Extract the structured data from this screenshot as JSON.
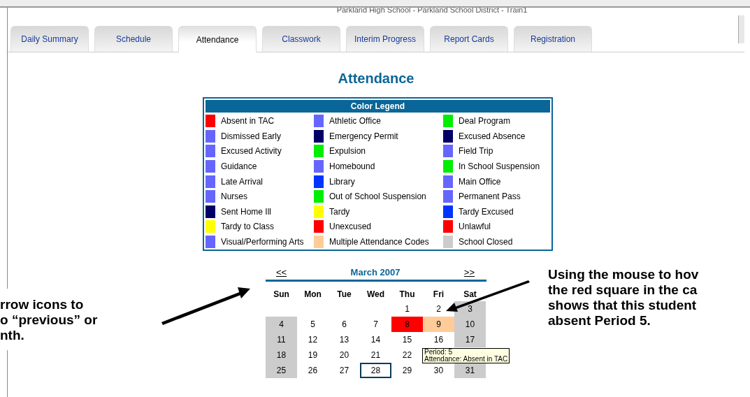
{
  "header": {
    "title": "Parkland High School - Parkland School District - Train1"
  },
  "tabs": [
    {
      "label": "Daily Summary",
      "selected": false
    },
    {
      "label": "Schedule",
      "selected": false
    },
    {
      "label": "Attendance",
      "selected": true
    },
    {
      "label": "Classwork",
      "selected": false
    },
    {
      "label": "Interim Progress",
      "selected": false
    },
    {
      "label": "Report Cards",
      "selected": false
    },
    {
      "label": "Registration",
      "selected": false
    }
  ],
  "page_title": "Attendance",
  "legend": {
    "title": "Color Legend",
    "items": [
      {
        "label": "Absent in TAC",
        "color": "#ff0000"
      },
      {
        "label": "Athletic Office",
        "color": "#6666ff"
      },
      {
        "label": "Deal Program",
        "color": "#00ee00"
      },
      {
        "label": "Dismissed Early",
        "color": "#6666ff"
      },
      {
        "label": "Emergency Permit",
        "color": "#000066"
      },
      {
        "label": "Excused Absence",
        "color": "#000066"
      },
      {
        "label": "Excused Activity",
        "color": "#6666ff"
      },
      {
        "label": "Expulsion",
        "color": "#00ee00"
      },
      {
        "label": "Field Trip",
        "color": "#6666ff"
      },
      {
        "label": "Guidance",
        "color": "#6666ff"
      },
      {
        "label": "Homebound",
        "color": "#6666ff"
      },
      {
        "label": "In School Suspension",
        "color": "#00ee00"
      },
      {
        "label": "Late Arrival",
        "color": "#6666ff"
      },
      {
        "label": "Library",
        "color": "#0033ff"
      },
      {
        "label": "Main Office",
        "color": "#6666ff"
      },
      {
        "label": "Nurses",
        "color": "#6666ff"
      },
      {
        "label": "Out of School Suspension",
        "color": "#00ee00"
      },
      {
        "label": "Permanent Pass",
        "color": "#6666ff"
      },
      {
        "label": "Sent Home Ill",
        "color": "#000066"
      },
      {
        "label": "Tardy",
        "color": "#ffff00"
      },
      {
        "label": "Tardy Excused",
        "color": "#0033ff"
      },
      {
        "label": "Tardy to Class",
        "color": "#ffff00"
      },
      {
        "label": "Unexcused",
        "color": "#ff0000"
      },
      {
        "label": "Unlawful",
        "color": "#ff0000"
      },
      {
        "label": "Visual/Performing Arts",
        "color": "#6666ff"
      },
      {
        "label": "Multiple Attendance Codes",
        "color": "#ffcc99"
      },
      {
        "label": "School Closed",
        "color": "#cccccc"
      }
    ]
  },
  "calendar": {
    "prev": "<<",
    "month": "March 2007",
    "next": ">>",
    "weekdays": [
      "Sun",
      "Mon",
      "Tue",
      "Wed",
      "Thu",
      "Fri",
      "Sat"
    ],
    "weeks": [
      [
        {
          "day": "1",
          "today": false
        },
        {
          "day": "2",
          "today": false
        },
        {
          "day": "3",
          "color": "#cccccc",
          "today": false
        }
      ],
      [
        {
          "day": "4",
          "color": "#cccccc",
          "today": false
        },
        {
          "day": "5",
          "today": false
        },
        {
          "day": "6",
          "today": false
        },
        {
          "day": "7",
          "today": false
        },
        {
          "day": "8",
          "color": "#ff0000",
          "today": false
        },
        {
          "day": "9",
          "color": "#ffcc99",
          "today": false
        },
        {
          "day": "10",
          "color": "#cccccc",
          "today": false
        }
      ],
      [
        {
          "day": "11",
          "color": "#cccccc",
          "today": false
        },
        {
          "day": "12",
          "today": false
        },
        {
          "day": "13",
          "today": false
        },
        {
          "day": "14",
          "today": false
        },
        {
          "day": "15",
          "today": false
        },
        {
          "day": "16",
          "today": false
        },
        {
          "day": "17",
          "color": "#cccccc",
          "today": false
        }
      ],
      [
        {
          "day": "18",
          "color": "#cccccc",
          "today": false
        },
        {
          "day": "19",
          "today": false
        },
        {
          "day": "20",
          "today": false
        },
        {
          "day": "21",
          "today": false
        },
        {
          "day": "22",
          "today": false
        }
      ],
      [
        {
          "day": "25",
          "color": "#cccccc",
          "today": false
        },
        {
          "day": "26",
          "today": false
        },
        {
          "day": "27",
          "today": false
        },
        {
          "day": "28",
          "today": true
        },
        {
          "day": "29",
          "today": false
        },
        {
          "day": "30",
          "today": false
        },
        {
          "day": "31",
          "color": "#cccccc",
          "today": false
        }
      ]
    ],
    "tooltip": [
      "Period: 5",
      "Attendance: Absent in TAC"
    ]
  },
  "annotations": [
    {
      "lines": [
        "rrow icons to",
        "o “previous” or",
        "nth."
      ]
    },
    {
      "lines": [
        "Using the mouse to hov",
        "the red square in the ca",
        "shows that this student",
        "absent Period 5."
      ]
    }
  ]
}
